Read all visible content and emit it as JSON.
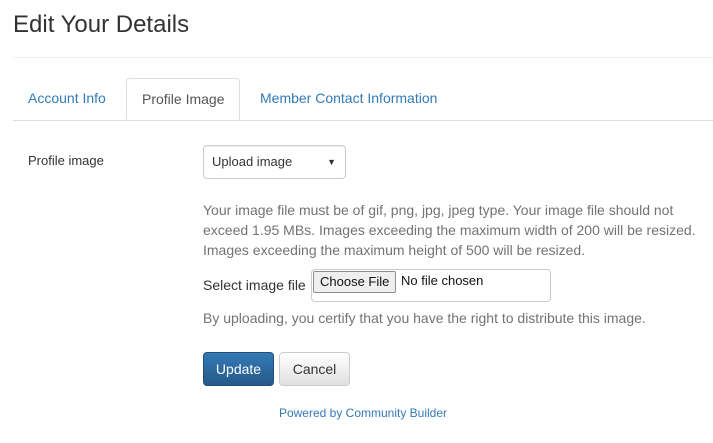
{
  "page": {
    "title": "Edit Your Details"
  },
  "tabs": [
    {
      "label": "Account Info",
      "active": false
    },
    {
      "label": "Profile Image",
      "active": true
    },
    {
      "label": "Member Contact Information",
      "active": false
    }
  ],
  "profile_image": {
    "label": "Profile image",
    "select": {
      "selected": "Upload image",
      "icon": "caret-down-icon"
    },
    "help_text": "Your image file must be of gif, png, jpg, jpeg type. Your image file should not exceed 1.95 MBs. Images exceeding the maximum width of 200 will be resized. Images exceeding the maximum height of 500 will be resized.",
    "file": {
      "label": "Select image file",
      "button_label": "Choose File",
      "status": "No file chosen"
    },
    "certify_text": "By uploading, you certify that you have the right to distribute this image."
  },
  "actions": {
    "update_label": "Update",
    "cancel_label": "Cancel"
  },
  "footer": {
    "powered_by": "Powered by Community Builder"
  },
  "colors": {
    "primary": "#337ab7",
    "link": "#337ab7",
    "muted_text": "#737373"
  }
}
